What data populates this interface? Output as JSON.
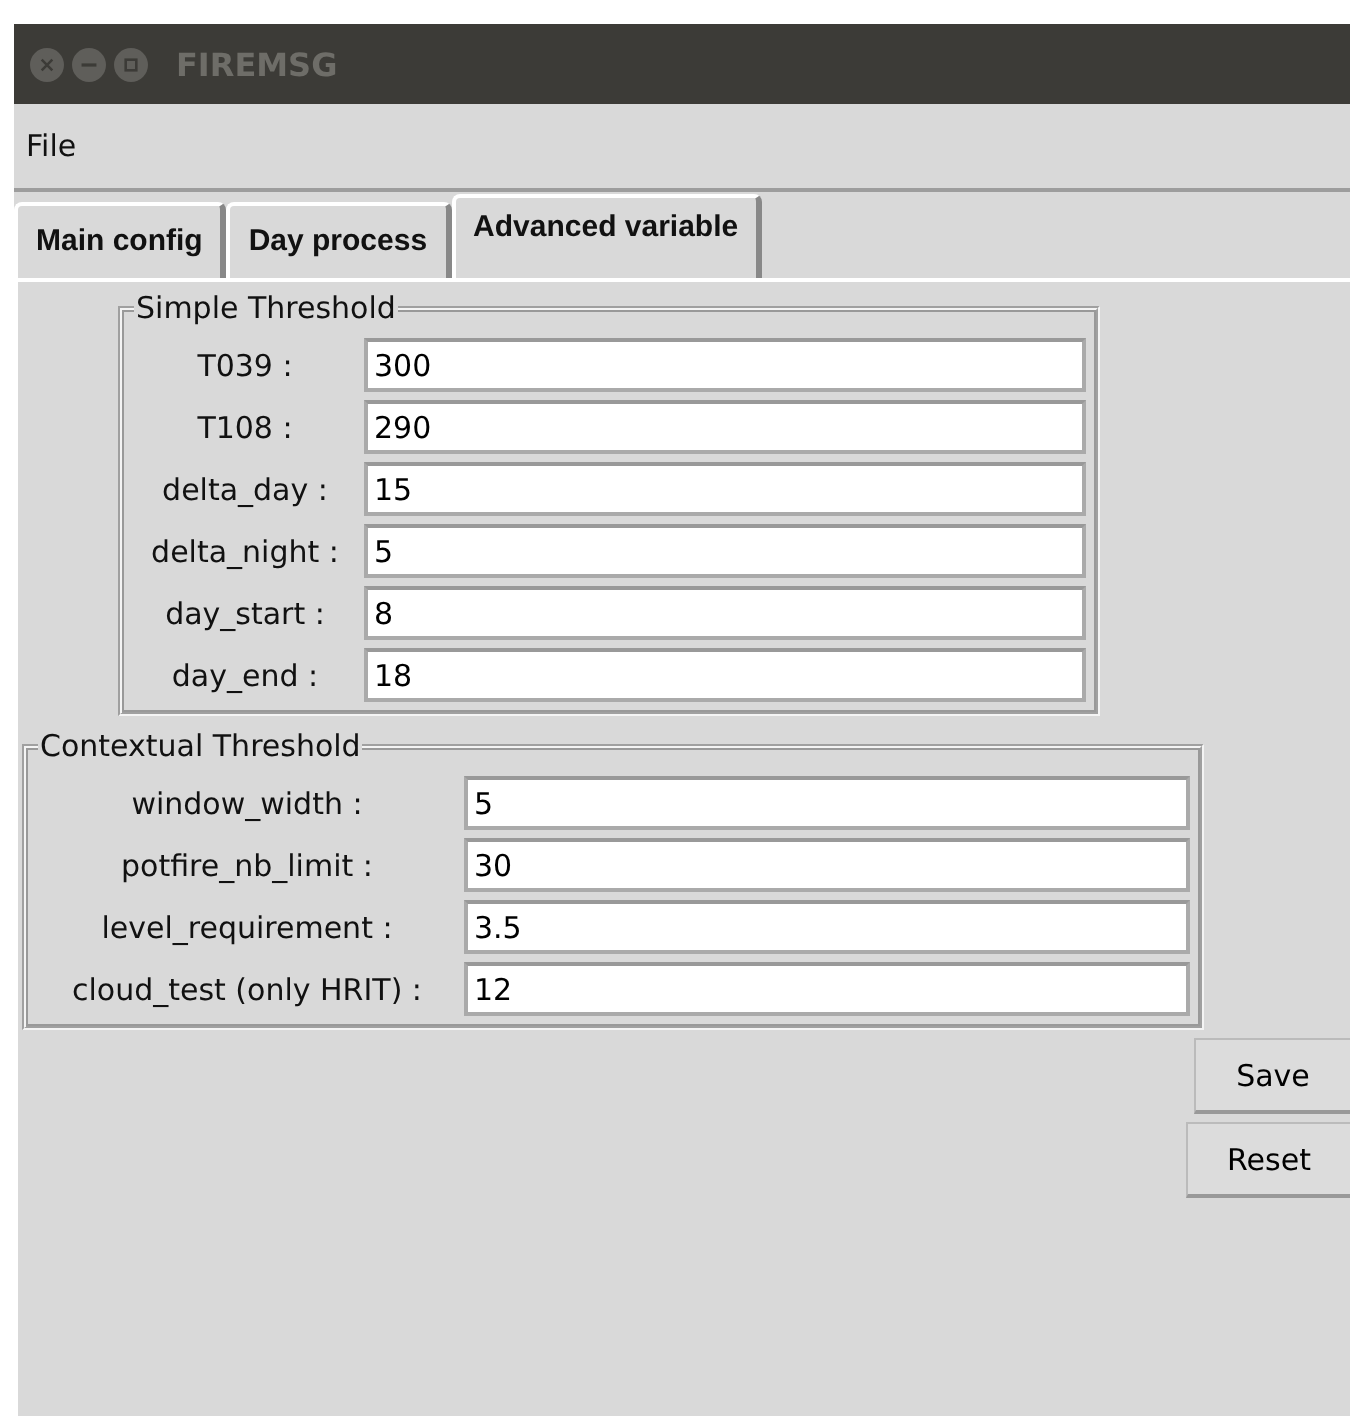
{
  "window": {
    "title": "FIREMSG"
  },
  "menu": [
    "File"
  ],
  "tabs": [
    {
      "label": "Main config",
      "selected": false
    },
    {
      "label": "Day process",
      "selected": false
    },
    {
      "label": "Advanced variable",
      "selected": true
    }
  ],
  "simple_threshold": {
    "title": "Simple Threshold",
    "fields": [
      {
        "label": "T039 :",
        "value": "300"
      },
      {
        "label": "T108 :",
        "value": "290"
      },
      {
        "label": "delta_day :",
        "value": "15"
      },
      {
        "label": "delta_night :",
        "value": "5"
      },
      {
        "label": "day_start :",
        "value": "8"
      },
      {
        "label": "day_end :",
        "value": "18"
      }
    ]
  },
  "contextual_threshold": {
    "title": "Contextual Threshold",
    "fields": [
      {
        "label": "window_width :",
        "value": "5"
      },
      {
        "label": "potfire_nb_limit :",
        "value": "30"
      },
      {
        "label": "level_requirement :",
        "value": "3.5"
      },
      {
        "label": "cloud_test (only HRIT) :",
        "value": "12"
      }
    ]
  },
  "buttons": [
    "Save",
    "Reset"
  ]
}
